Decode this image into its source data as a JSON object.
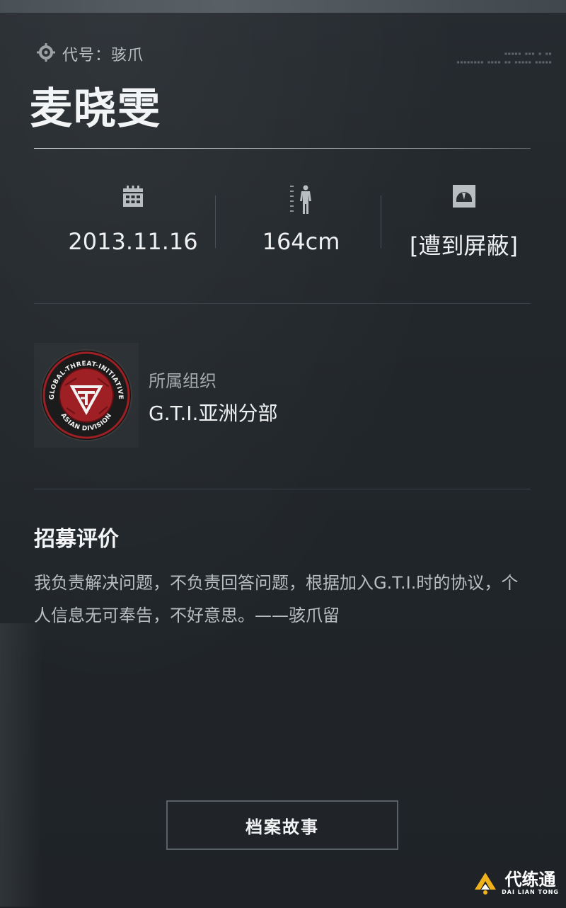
{
  "header": {
    "codename": "代号：骇爪",
    "name": "麦晓雯"
  },
  "stats": {
    "birthday": "2013.11.16",
    "height": "164cm",
    "weight": "[遭到屏蔽]"
  },
  "organization": {
    "label": "所属组织",
    "value": "G.T.I.亚洲分部",
    "badge_text": [
      "GLOBAL-THREAT-INITIATIVE",
      "ASIAN DIVISION"
    ]
  },
  "review": {
    "title": "招募评价",
    "text": "我负责解决问题，不负责回答问题，根据加入G.T.I.时的协议，个人信息无可奉告，不好意思。——骇爪留"
  },
  "actions": {
    "archive_story": "档案故事"
  },
  "watermark": {
    "title": "代练通",
    "subtitle": "DAI LIAN TONG"
  },
  "colors": {
    "badge_red": "#9e1f24",
    "watermark_gold": "#f0b21a"
  },
  "icons": [
    "crosshair-icon",
    "calendar-icon",
    "height-icon",
    "weight-scale-icon",
    "gti-emblem-icon",
    "watermark-logo-icon"
  ]
}
